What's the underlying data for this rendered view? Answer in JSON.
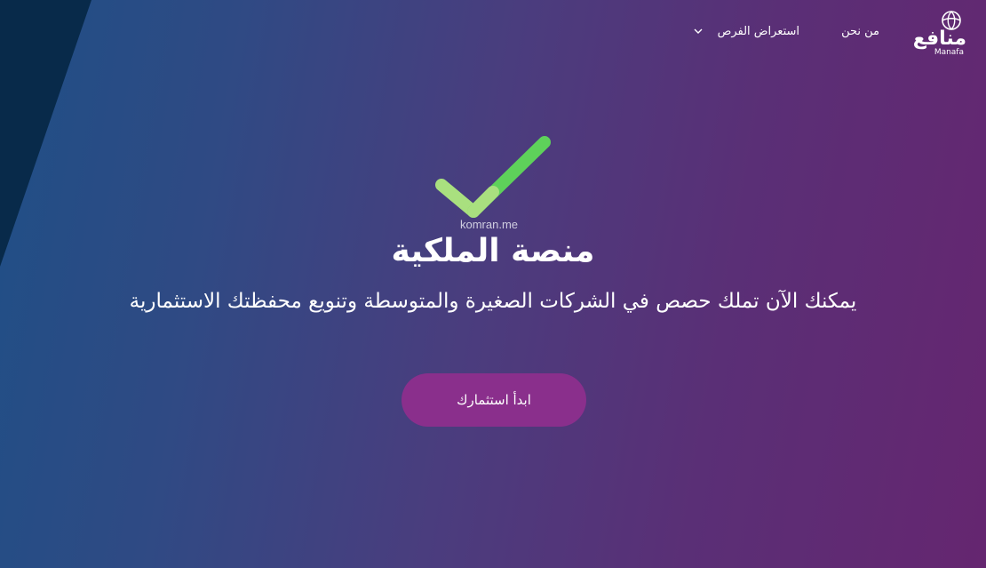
{
  "brand": {
    "name_ar": "منافع",
    "name_en": "Manafa"
  },
  "nav": {
    "about": "من نحن",
    "browse_opportunities": "استعراض الفرص"
  },
  "hero": {
    "watermark": "komran.me",
    "title": "منصة الملكية",
    "subtitle": "يمكنك الآن تملك حصص في الشركات الصغيرة والمتوسطة وتنويع محفظتك الاستثمارية",
    "cta_label": "ابدأ استثمارك"
  },
  "icons": {
    "logo": "manafa-logo-icon",
    "dropdown": "chevron-down-icon",
    "success": "checkmark-icon"
  },
  "colors": {
    "gradient_start": "#1f4f86",
    "gradient_end": "#652670",
    "side_shape": "#082a4a",
    "cta": "#8a2f8c",
    "check_light": "#a9e07f",
    "check_dark": "#5ed15a"
  }
}
